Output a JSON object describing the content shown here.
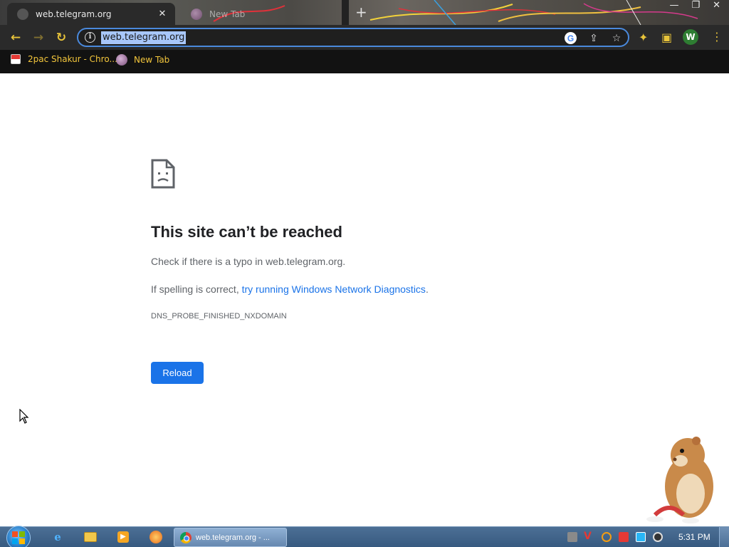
{
  "browser": {
    "tabs": [
      {
        "title": "web.telegram.org",
        "active": true
      },
      {
        "title": "New Tab",
        "active": false
      }
    ],
    "address_bar": {
      "url": "web.telegram.org"
    },
    "bookmarks": [
      {
        "label": "2pac Shakur - Chro..."
      },
      {
        "label": "New Tab"
      }
    ],
    "profile_initial": "W",
    "accent_color": "#e7c33a"
  },
  "error_page": {
    "title": "This site can’t be reached",
    "line1": "Check if there is a typo in web.telegram.org.",
    "line2_prefix": "If spelling is correct, ",
    "line2_link": "try running Windows Network Diagnostics",
    "line2_suffix": ".",
    "error_code": "DNS_PROBE_FINISHED_NXDOMAIN",
    "reload_label": "Reload",
    "link_color": "#1a73e8",
    "button_color": "#1a73e8"
  },
  "taskbar": {
    "active_task": "web.telegram.org - ...",
    "clock": "5:31 PM"
  }
}
